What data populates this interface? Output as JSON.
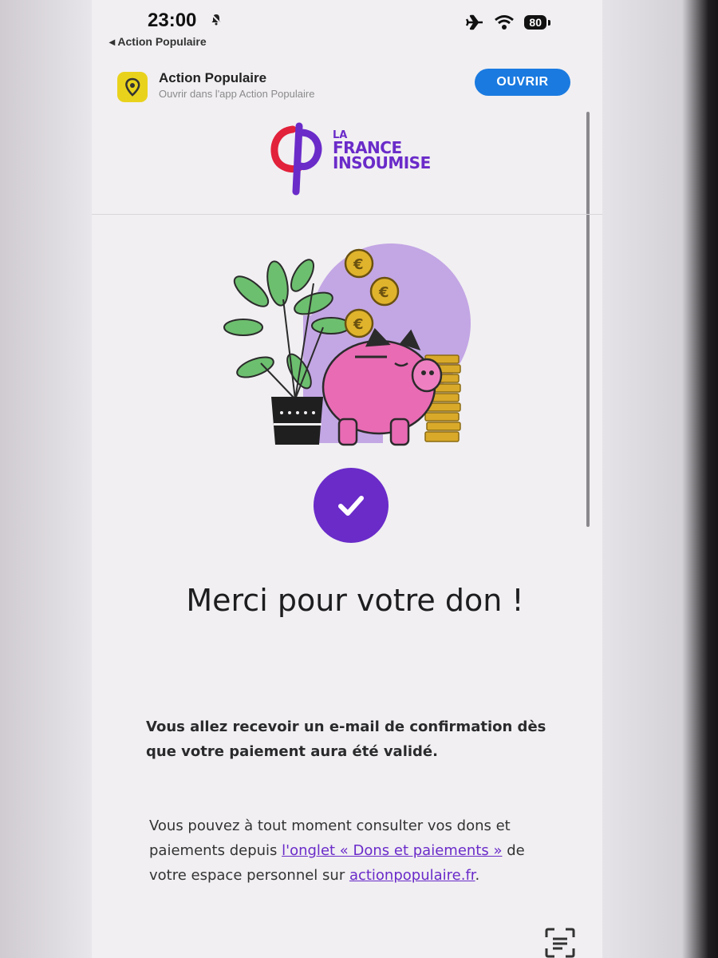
{
  "status_bar": {
    "time": "23:00",
    "back_label": "◂ Action Populaire",
    "battery": "80",
    "icons": [
      "bell-muted-icon",
      "airplane-icon",
      "wifi-icon",
      "battery-icon"
    ]
  },
  "app_banner": {
    "app_name": "Action Populaire",
    "subtitle": "Ouvrir dans l'app Action Populaire",
    "open_label": "OUVRIR",
    "icon_color": "#e9d21c",
    "button_color": "#1a7ae0"
  },
  "logo": {
    "line1": "LA",
    "line2": "FRANCE",
    "line3": "INSOUMISE"
  },
  "illustration": {
    "icon": "piggy-bank-icon"
  },
  "confirmation": {
    "title": "Merci pour votre don !",
    "message": "Vous allez recevoir un e-mail de confirmation dès que votre paiement aura été validé.",
    "info_prefix": "Vous pouvez à tout moment consulter vos dons et paiements depuis ",
    "info_link": "l'onglet « Dons et paiements »",
    "info_middle": " de votre espace personnel sur ",
    "info_site": "actionpopulaire.fr",
    "info_suffix": "."
  },
  "colors": {
    "accent": "#6a2bc9",
    "piggy": "#e96bb4",
    "coin": "#d9a92a",
    "plant": "#6cbf6e",
    "background_circle": "#c3a6e4"
  }
}
